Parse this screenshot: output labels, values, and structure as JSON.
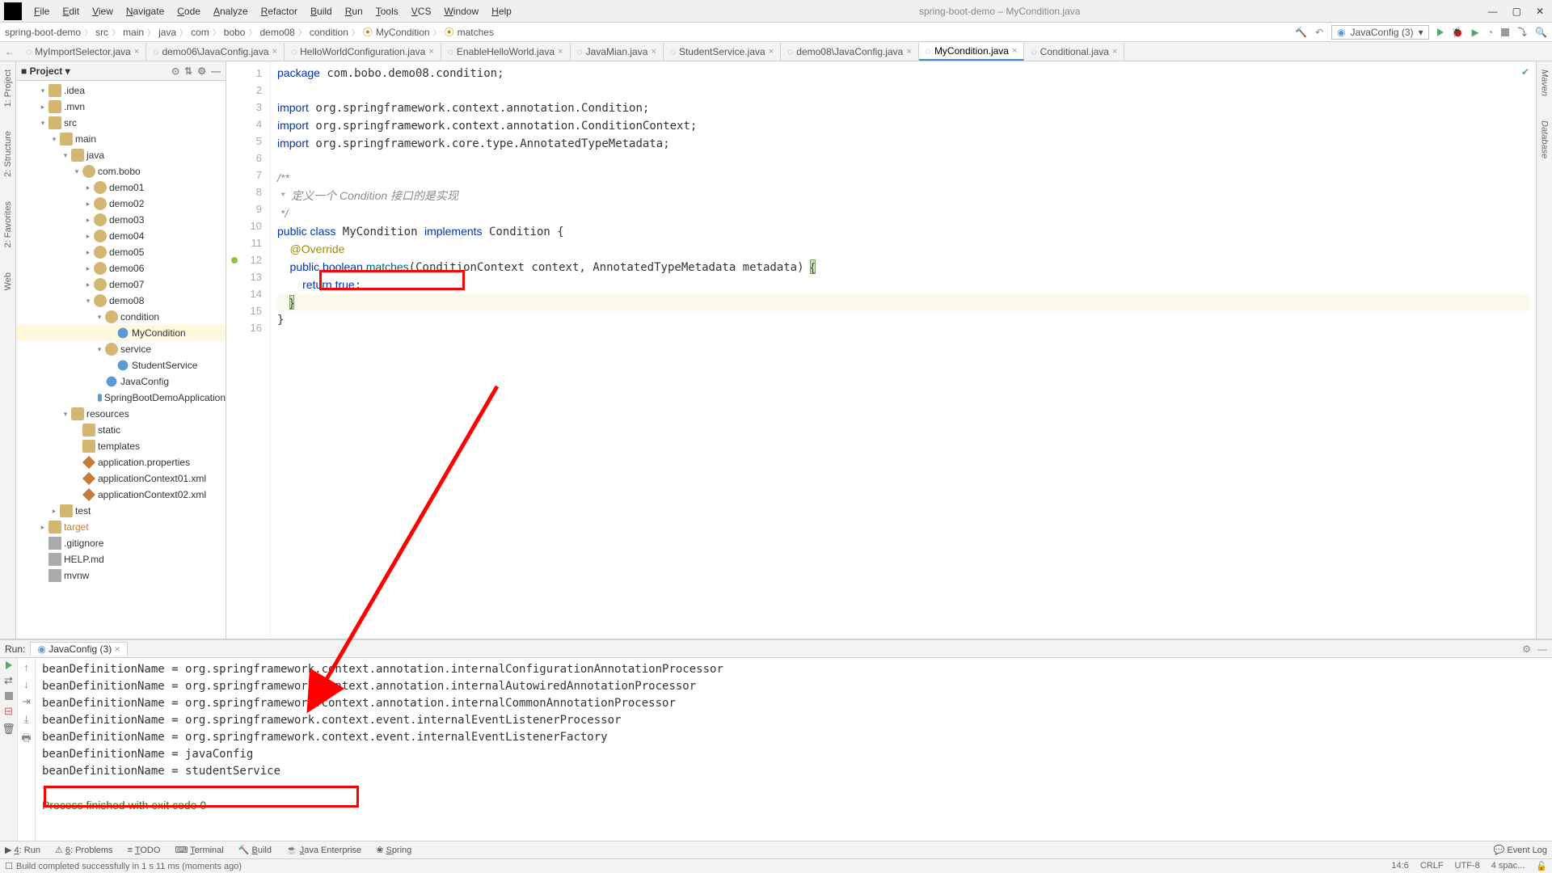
{
  "title": "spring-boot-demo – MyCondition.java",
  "menu": [
    "File",
    "Edit",
    "View",
    "Navigate",
    "Code",
    "Analyze",
    "Refactor",
    "Build",
    "Run",
    "Tools",
    "VCS",
    "Window",
    "Help"
  ],
  "breadcrumbs": [
    "spring-boot-demo",
    "src",
    "main",
    "java",
    "com",
    "bobo",
    "demo08",
    "condition",
    "MyCondition",
    "matches"
  ],
  "runconfig": "JavaConfig (3)",
  "tabs": [
    {
      "label": "MyImportSelector.java",
      "active": false
    },
    {
      "label": "demo06\\JavaConfig.java",
      "active": false
    },
    {
      "label": "HelloWorldConfiguration.java",
      "active": false
    },
    {
      "label": "EnableHelloWorld.java",
      "active": false
    },
    {
      "label": "JavaMian.java",
      "active": false
    },
    {
      "label": "StudentService.java",
      "active": false
    },
    {
      "label": "demo08\\JavaConfig.java",
      "active": false
    },
    {
      "label": "MyCondition.java",
      "active": true
    },
    {
      "label": "Conditional.java",
      "active": false
    }
  ],
  "project_header": "Project",
  "tree": [
    {
      "d": 1,
      "t": "v",
      "i": "folder",
      "l": ".idea"
    },
    {
      "d": 1,
      "t": ">",
      "i": "folder",
      "l": ".mvn"
    },
    {
      "d": 1,
      "t": "v",
      "i": "folder",
      "l": "src"
    },
    {
      "d": 2,
      "t": "v",
      "i": "folder",
      "l": "main"
    },
    {
      "d": 3,
      "t": "v",
      "i": "folder",
      "l": "java"
    },
    {
      "d": 4,
      "t": "v",
      "i": "pkg",
      "l": "com.bobo"
    },
    {
      "d": 5,
      "t": ">",
      "i": "pkg",
      "l": "demo01"
    },
    {
      "d": 5,
      "t": ">",
      "i": "pkg",
      "l": "demo02"
    },
    {
      "d": 5,
      "t": ">",
      "i": "pkg",
      "l": "demo03"
    },
    {
      "d": 5,
      "t": ">",
      "i": "pkg",
      "l": "demo04"
    },
    {
      "d": 5,
      "t": ">",
      "i": "pkg",
      "l": "demo05"
    },
    {
      "d": 5,
      "t": ">",
      "i": "pkg",
      "l": "demo06"
    },
    {
      "d": 5,
      "t": ">",
      "i": "pkg",
      "l": "demo07"
    },
    {
      "d": 5,
      "t": "v",
      "i": "pkg",
      "l": "demo08"
    },
    {
      "d": 6,
      "t": "v",
      "i": "pkg",
      "l": "condition"
    },
    {
      "d": 7,
      "t": "",
      "i": "java",
      "l": "MyCondition",
      "sel": true
    },
    {
      "d": 6,
      "t": "v",
      "i": "pkg",
      "l": "service"
    },
    {
      "d": 7,
      "t": "",
      "i": "java",
      "l": "StudentService"
    },
    {
      "d": 6,
      "t": "",
      "i": "java",
      "l": "JavaConfig"
    },
    {
      "d": 6,
      "t": "",
      "i": "java",
      "l": "SpringBootDemoApplication"
    },
    {
      "d": 3,
      "t": "v",
      "i": "folder-o",
      "l": "resources"
    },
    {
      "d": 4,
      "t": "",
      "i": "folder",
      "l": "static"
    },
    {
      "d": 4,
      "t": "",
      "i": "folder",
      "l": "templates"
    },
    {
      "d": 4,
      "t": "",
      "i": "xml",
      "l": "application.properties"
    },
    {
      "d": 4,
      "t": "",
      "i": "xml",
      "l": "applicationContext01.xml"
    },
    {
      "d": 4,
      "t": "",
      "i": "xml",
      "l": "applicationContext02.xml"
    },
    {
      "d": 2,
      "t": ">",
      "i": "folder",
      "l": "test"
    },
    {
      "d": 1,
      "t": ">",
      "i": "folder-o",
      "l": "target",
      "sel": false,
      "hl": true
    },
    {
      "d": 1,
      "t": "",
      "i": "file",
      "l": ".gitignore"
    },
    {
      "d": 1,
      "t": "",
      "i": "file",
      "l": "HELP.md"
    },
    {
      "d": 1,
      "t": "",
      "i": "file",
      "l": "mvnw"
    }
  ],
  "gutter_lines": [
    "1",
    "2",
    "3",
    "4",
    "5",
    "6",
    "7",
    "8",
    "9",
    "10",
    "11",
    "12",
    "13",
    "14",
    "15",
    "16"
  ],
  "code": {
    "l1a": "package",
    "l1b": " com.bobo.demo08.condition;",
    "l3a": "import",
    "l3b": " org.springframework.context.annotation.Condition;",
    "l4a": "import",
    "l4b": " org.springframework.context.annotation.ConditionContext;",
    "l5a": "import",
    "l5b": " org.springframework.core.type.AnnotatedTypeMetadata;",
    "l7": "/**",
    "l8": " *  定义一个 Condition 接口的是实现",
    "l9": " */",
    "l10a": "public class",
    "l10b": " MyCondition ",
    "l10c": "implements",
    "l10d": " Condition {",
    "l11": "    @Override",
    "l12a": "    public boolean ",
    "l12b": "matches",
    "l12c": "(ConditionContext context, AnnotatedTypeMetadata metadata) ",
    "l12d": "{",
    "l13a": "        return ",
    "l13b": "true",
    "l13c": ";",
    "l14": "    }",
    "l15": "}"
  },
  "run": {
    "label": "Run:",
    "tab": "JavaConfig (3)",
    "lines": [
      "beanDefinitionName = org.springframework.context.annotation.internalConfigurationAnnotationProcessor",
      "beanDefinitionName = org.springframework.context.annotation.internalAutowiredAnnotationProcessor",
      "beanDefinitionName = org.springframework.context.annotation.internalCommonAnnotationProcessor",
      "beanDefinitionName = org.springframework.context.event.internalEventListenerProcessor",
      "beanDefinitionName = org.springframework.context.event.internalEventListenerFactory",
      "beanDefinitionName = javaConfig",
      "beanDefinitionName = studentService"
    ],
    "exit": "Process finished with exit code 0"
  },
  "toolwins": [
    "4: Run",
    "6: Problems",
    "TODO",
    "Terminal",
    "Build",
    "Java Enterprise",
    "Spring"
  ],
  "eventlog": "Event Log",
  "status_left": "Build completed successfully in 1 s 11 ms (moments ago)",
  "status_right": [
    "14:6",
    "CRLF",
    "UTF-8",
    "4 spac..."
  ],
  "left_tabs": [
    "1: Project",
    "2: Structure",
    "2: Favorites",
    "Web"
  ],
  "right_tabs": [
    "Maven",
    "Database"
  ]
}
